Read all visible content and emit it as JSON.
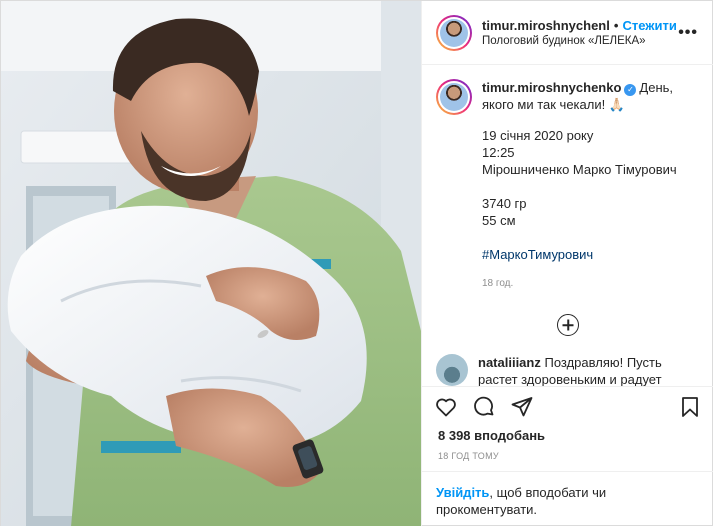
{
  "header": {
    "username": "timur.miroshnychenl",
    "separator": "•",
    "follow_label": "Стежити",
    "location": "Пологовий будинок «ЛЕЛЕКА»",
    "more_icon": "more-dots-icon"
  },
  "caption": {
    "username": "timur.miroshnychenko",
    "text": "День, якого ми так чекали! 🙏🏻",
    "lines": [
      "19 січня 2020 року",
      "12:25",
      "Мірошниченко Марко Тімурович"
    ],
    "lines2": [
      "3740 гр",
      "55 см"
    ],
    "hashtag": "#МаркоТимурович",
    "time": "18 год."
  },
  "comment": {
    "username": "nataliiianz",
    "text": "Поздравляю! Пусть растет здоровеньким и радует"
  },
  "actions": {
    "icons": [
      "heart-icon",
      "comment-icon",
      "share-icon",
      "bookmark-icon"
    ]
  },
  "likes": "8 398 вподобань",
  "time_ago": "18 ГОД ТОМУ",
  "login": {
    "link": "Увійдіть",
    "text": ", щоб вподобати чи прокоментувати."
  },
  "colors": {
    "accent": "#0095f6",
    "verified": "#3897f0",
    "hashtag": "#00376b"
  }
}
